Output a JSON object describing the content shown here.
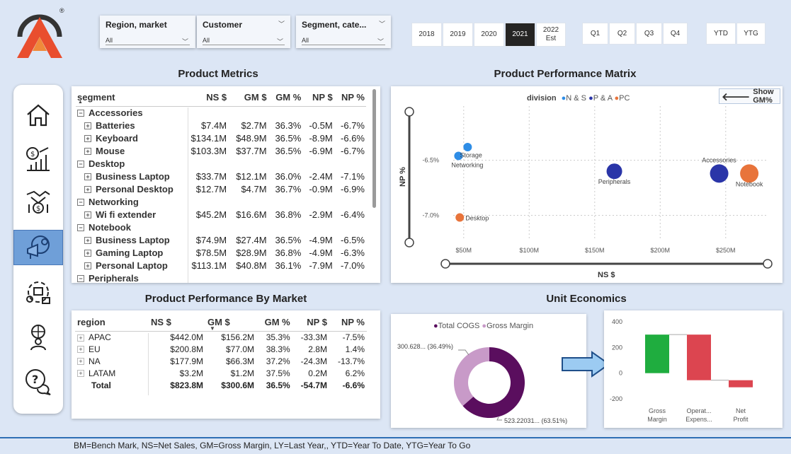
{
  "filters": {
    "region": {
      "label": "Region, market",
      "value": "All"
    },
    "customer": {
      "label": "Customer",
      "value": "All"
    },
    "segment": {
      "label": "Segment, cate...",
      "value": "All"
    }
  },
  "years": [
    "2018",
    "2019",
    "2020",
    "2021"
  ],
  "year_est": {
    "line1": "2022",
    "line2": "Est"
  },
  "selected_year": "2021",
  "quarters": [
    "Q1",
    "Q2",
    "Q3",
    "Q4"
  ],
  "periods": [
    "YTD",
    "YTG"
  ],
  "product_metrics": {
    "title": "Product Metrics",
    "headers": [
      "segment",
      "NS $",
      "GM $",
      "GM %",
      "NP $",
      "NP %"
    ],
    "rows": [
      {
        "level": 0,
        "name": "Accessories"
      },
      {
        "level": 1,
        "name": "Batteries",
        "ns": "$7.4M",
        "gm": "$2.7M",
        "gmp": "36.3%",
        "np": "-0.5M",
        "npp": "-6.7%"
      },
      {
        "level": 1,
        "name": "Keyboard",
        "ns": "$134.1M",
        "gm": "$48.9M",
        "gmp": "36.5%",
        "np": "-8.9M",
        "npp": "-6.6%"
      },
      {
        "level": 1,
        "name": "Mouse",
        "ns": "$103.3M",
        "gm": "$37.7M",
        "gmp": "36.5%",
        "np": "-6.9M",
        "npp": "-6.7%"
      },
      {
        "level": 0,
        "name": "Desktop"
      },
      {
        "level": 1,
        "name": "Business Laptop",
        "ns": "$33.7M",
        "gm": "$12.1M",
        "gmp": "36.0%",
        "np": "-2.4M",
        "npp": "-7.1%"
      },
      {
        "level": 1,
        "name": "Personal Desktop",
        "ns": "$12.7M",
        "gm": "$4.7M",
        "gmp": "36.7%",
        "np": "-0.9M",
        "npp": "-6.9%"
      },
      {
        "level": 0,
        "name": "Networking"
      },
      {
        "level": 1,
        "name": "Wi fi extender",
        "ns": "$45.2M",
        "gm": "$16.6M",
        "gmp": "36.8%",
        "np": "-2.9M",
        "npp": "-6.4%"
      },
      {
        "level": 0,
        "name": "Notebook"
      },
      {
        "level": 1,
        "name": "Business Laptop",
        "ns": "$74.9M",
        "gm": "$27.4M",
        "gmp": "36.5%",
        "np": "-4.9M",
        "npp": "-6.5%"
      },
      {
        "level": 1,
        "name": "Gaming Laptop",
        "ns": "$78.5M",
        "gm": "$28.9M",
        "gmp": "36.8%",
        "np": "-4.9M",
        "npp": "-6.3%"
      },
      {
        "level": 1,
        "name": "Personal Laptop",
        "ns": "$113.1M",
        "gm": "$40.8M",
        "gmp": "36.1%",
        "np": "-7.9M",
        "npp": "-7.0%"
      },
      {
        "level": 0,
        "name": "Peripherals"
      }
    ]
  },
  "matrix": {
    "title": "Product Performance Matrix",
    "legend_title": "division",
    "legend": [
      {
        "name": "N & S",
        "color": "#2e8de6"
      },
      {
        "name": "P & A",
        "color": "#2a35a8"
      },
      {
        "name": "PC",
        "color": "#e8743b"
      }
    ],
    "show_gm": "Show GM%",
    "ylabel": "NP %",
    "xlabel": "NS $",
    "y_ticks": [
      "-6.5%",
      "-7.0%"
    ],
    "x_ticks": [
      "$50M",
      "$100M",
      "$150M",
      "$200M",
      "$250M"
    ]
  },
  "chart_data": [
    {
      "type": "scatter",
      "title": "Product Performance Matrix",
      "xlabel": "NS $",
      "ylabel": "NP %",
      "xlim": [
        42,
        282
      ],
      "ylim": [
        -7.1,
        -6.2
      ],
      "series": [
        {
          "name": "N & S",
          "points": [
            {
              "label": "",
              "x": 53,
              "y": -6.38
            },
            {
              "label": "Storage",
              "x": 46,
              "y": -6.46
            },
            {
              "label": "Networking",
              "x": 46,
              "y": -6.46
            }
          ]
        },
        {
          "name": "P & A",
          "points": [
            {
              "label": "Peripherals",
              "x": 165,
              "y": -6.6
            },
            {
              "label": "Accessories",
              "x": 245,
              "y": -6.62
            }
          ]
        },
        {
          "name": "PC",
          "points": [
            {
              "label": "Notebook",
              "x": 268,
              "y": -6.62
            },
            {
              "label": "Desktop",
              "x": 47,
              "y": -7.02
            }
          ]
        }
      ]
    },
    {
      "type": "pie",
      "title": "",
      "series": [
        {
          "name": "Total COGS",
          "value": 523.22031,
          "pct": 63.51,
          "color": "#5a0e5e"
        },
        {
          "name": "Gross Margin",
          "value": 300.628,
          "pct": 36.49,
          "color": "#c89ac8"
        }
      ]
    },
    {
      "type": "bar",
      "title": "Unit Economics",
      "categories": [
        "Gross Margin",
        "Operat... Expens...",
        "Net Profit"
      ],
      "values": [
        300,
        -355,
        -55
      ],
      "ylim": [
        -200,
        400
      ]
    }
  ],
  "market": {
    "title": "Product Performance By Market",
    "headers": [
      "region",
      "NS $",
      "GM $",
      "GM %",
      "NP $",
      "NP %"
    ],
    "rows": [
      {
        "name": "APAC",
        "ns": "$442.0M",
        "gm": "$156.2M",
        "gmp": "35.3%",
        "np": "-33.3M",
        "npp": "-7.5%"
      },
      {
        "name": "EU",
        "ns": "$200.8M",
        "gm": "$77.0M",
        "gmp": "38.3%",
        "np": "2.8M",
        "npp": "1.4%"
      },
      {
        "name": "NA",
        "ns": "$177.9M",
        "gm": "$66.3M",
        "gmp": "37.2%",
        "np": "-24.3M",
        "npp": "-13.7%"
      },
      {
        "name": "LATAM",
        "ns": "$3.2M",
        "gm": "$1.2M",
        "gmp": "37.5%",
        "np": "0.2M",
        "npp": "6.2%"
      }
    ],
    "total": {
      "name": "Total",
      "ns": "$823.8M",
      "gm": "$300.6M",
      "gmp": "36.5%",
      "np": "-54.7M",
      "npp": "-6.6%"
    }
  },
  "unit_economics": {
    "title": "Unit Economics",
    "donut_label_gm": "300.628... (36.49%)",
    "donut_label_cogs": "523.22031... (63.51%)",
    "y_ticks": [
      "400",
      "200",
      "0",
      "-200"
    ],
    "x_labels": [
      "Gross\nMargin",
      "Operat...\nExpens...",
      "Net\nProfit"
    ]
  },
  "footer": "BM=Bench Mark, NS=Net Sales, GM=Gross Margin, LY=Last Year,, YTD=Year To Date, YTG=Year To Go",
  "logo_mark": "®",
  "colors": {
    "accent": "#2f6fb5",
    "selected": "#252423",
    "gm_green": "#1fad3f",
    "loss_red": "#dc4550"
  }
}
